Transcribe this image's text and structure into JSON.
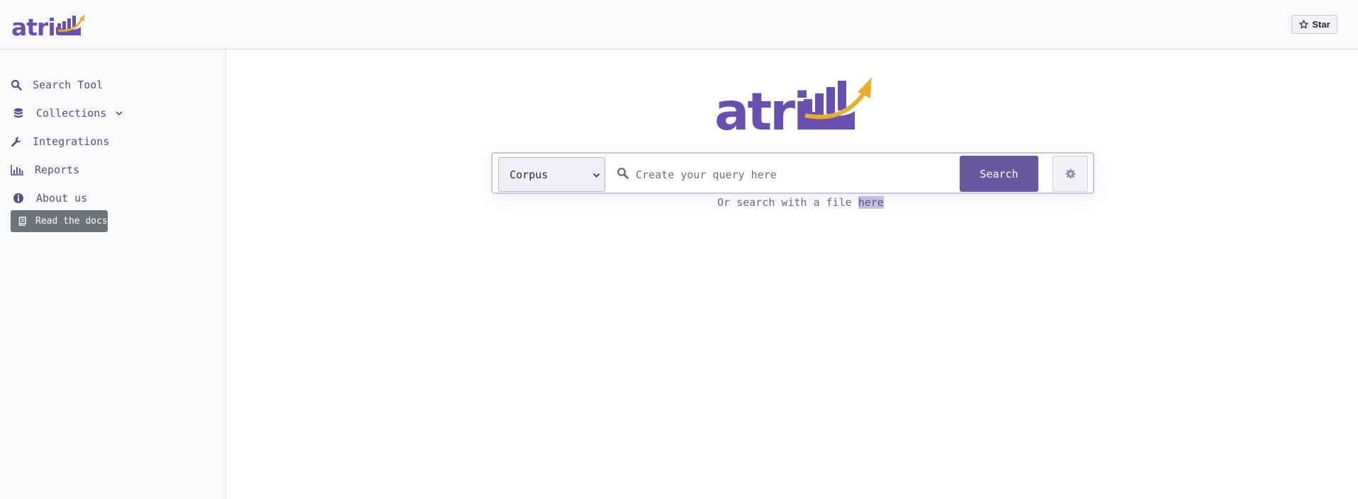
{
  "header": {
    "logo_text": "atri",
    "star_label": "Star"
  },
  "sidebar": {
    "items": [
      {
        "label": "Search Tool",
        "icon": "search-icon"
      },
      {
        "label": "Collections",
        "icon": "database-icon",
        "expandable": true
      },
      {
        "label": "Integrations",
        "icon": "wrench-icon"
      },
      {
        "label": "Reports",
        "icon": "bar-chart-icon"
      },
      {
        "label": "About us",
        "icon": "info-circle-icon"
      }
    ],
    "docs_button": {
      "label": "Read the docs",
      "icon": "book-icon"
    }
  },
  "main": {
    "logo_text": "atri",
    "search": {
      "selected_collection": "Corpus",
      "placeholder": "Create your query here",
      "value": "",
      "button_label": "Search",
      "settings_icon": "gear-icon"
    },
    "file_hint": {
      "prefix": "Or search with a file ",
      "link": "here"
    }
  },
  "colors": {
    "brand_purple": "#67589f",
    "logo_purple": "#6a4fb0",
    "logo_gold": "#e6b02e",
    "sidebar_bg": "#f8f9fa",
    "docs_button_bg": "#6c737b"
  }
}
